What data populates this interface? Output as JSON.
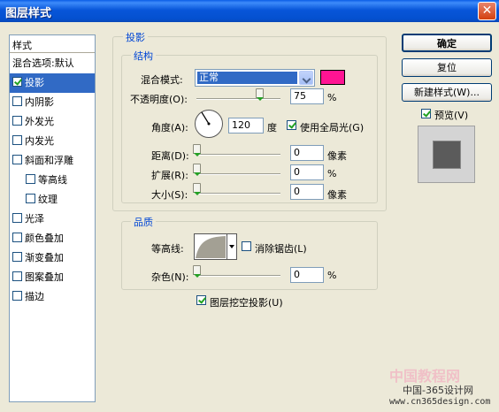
{
  "window": {
    "title": "图层样式",
    "close_glyph": "✕"
  },
  "stylelist": {
    "header": "样式",
    "items": [
      {
        "label": "混合选项:默认",
        "checkbox": false,
        "checked": false,
        "selected": false,
        "indent": false
      },
      {
        "label": "投影",
        "checkbox": true,
        "checked": true,
        "selected": true,
        "indent": false
      },
      {
        "label": "内阴影",
        "checkbox": true,
        "checked": false,
        "selected": false,
        "indent": false
      },
      {
        "label": "外发光",
        "checkbox": true,
        "checked": false,
        "selected": false,
        "indent": false
      },
      {
        "label": "内发光",
        "checkbox": true,
        "checked": false,
        "selected": false,
        "indent": false
      },
      {
        "label": "斜面和浮雕",
        "checkbox": true,
        "checked": false,
        "selected": false,
        "indent": false
      },
      {
        "label": "等高线",
        "checkbox": true,
        "checked": false,
        "selected": false,
        "indent": true
      },
      {
        "label": "纹理",
        "checkbox": true,
        "checked": false,
        "selected": false,
        "indent": true
      },
      {
        "label": "光泽",
        "checkbox": true,
        "checked": false,
        "selected": false,
        "indent": false
      },
      {
        "label": "颜色叠加",
        "checkbox": true,
        "checked": false,
        "selected": false,
        "indent": false
      },
      {
        "label": "渐变叠加",
        "checkbox": true,
        "checked": false,
        "selected": false,
        "indent": false
      },
      {
        "label": "图案叠加",
        "checkbox": true,
        "checked": false,
        "selected": false,
        "indent": false
      },
      {
        "label": "描边",
        "checkbox": true,
        "checked": false,
        "selected": false,
        "indent": false
      }
    ]
  },
  "shadow": {
    "group_title": "投影",
    "structure_title": "结构",
    "blend_mode": {
      "label": "混合模式:",
      "value": "正常",
      "color": "#ff1493"
    },
    "opacity": {
      "label": "不透明度(O):",
      "value": "75",
      "unit": "%",
      "level": 0.75
    },
    "angle": {
      "label": "角度(A):",
      "value": "120",
      "unit": "度",
      "global_light_label": "使用全局光(G)",
      "global_light_checked": true
    },
    "distance": {
      "label": "距离(D):",
      "value": "0",
      "unit": "像素",
      "level": 0
    },
    "spread": {
      "label": "扩展(R):",
      "value": "0",
      "unit": "%",
      "level": 0
    },
    "size": {
      "label": "大小(S):",
      "value": "0",
      "unit": "像素",
      "level": 0
    }
  },
  "quality": {
    "title": "品质",
    "contour_label": "等高线:",
    "antialias_label": "消除锯齿(L)",
    "antialias_checked": false,
    "noise": {
      "label": "杂色(N):",
      "value": "0",
      "unit": "%",
      "level": 0
    }
  },
  "knockout": {
    "label": "图层挖空投影(U)",
    "checked": true
  },
  "buttons": {
    "ok": "确定",
    "reset": "复位",
    "new_style": "新建样式(W)...",
    "preview_label": "预览(V)",
    "preview_checked": true
  },
  "watermark": {
    "line1": "中国教程网",
    "line2": "中国-365设计网",
    "line3": "www.cn365design.com"
  }
}
